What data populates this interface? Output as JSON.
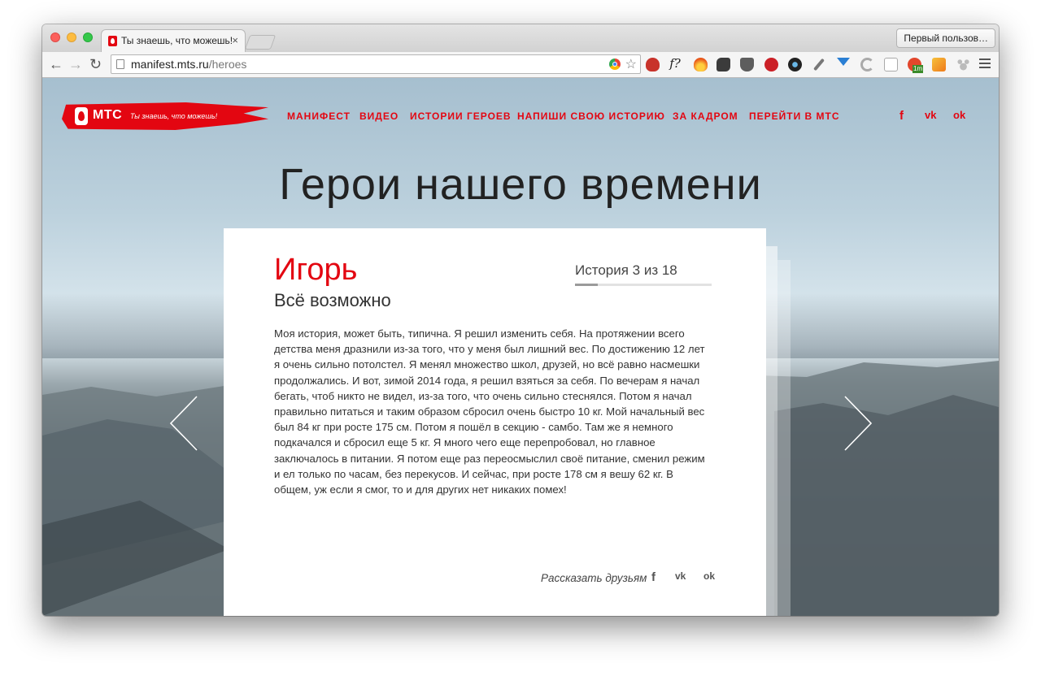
{
  "browser": {
    "tab_title": "Ты знаешь, что можешь!",
    "tab_close": "×",
    "profile_label": "Первый пользов…",
    "url_host": "manifest.mts.ru",
    "url_path": "/heroes",
    "back": "←",
    "forward": "→",
    "reload": "↻",
    "star": "☆",
    "extension_icons": [
      "ublock-icon",
      "font-icon",
      "flame-icon",
      "evernote-icon",
      "pocket-icon",
      "pinterest-icon",
      "lens-icon",
      "eyedropper-icon",
      "yandex-icon",
      "spinner-icon",
      "reader-icon",
      "badge-1m-icon",
      "chart-icon",
      "paw-icon"
    ],
    "ext_font_label": "f?",
    "ext_badge": "1m"
  },
  "site": {
    "brand": "МТС",
    "slogan": "Ты знаешь, что можешь!",
    "accent_color": "#e30611",
    "nav": [
      "МАНИФЕСТ",
      "ВИДЕО",
      "ИСТОРИИ ГЕРОЕВ",
      "НАПИШИ СВОЮ ИСТОРИЮ",
      "ЗА КАДРОМ",
      "ПЕРЕЙТИ В МТС"
    ],
    "social": [
      "f",
      "vk",
      "ok"
    ],
    "social_labels": {
      "facebook": "f",
      "vk": "vk",
      "ok": "ok"
    }
  },
  "hero": {
    "title": "Герои нашего времени"
  },
  "story": {
    "name": "Игорь",
    "subtitle": "Всё возможно",
    "counter": "История 3 из 18",
    "progress_fraction": 0.1667,
    "text": "Моя история, может быть, типична. Я решил изменить себя. На протяжении всего детства меня дразнили из-за того, что у меня был лишний вес. По достижению 12 лет я очень сильно потолстел. Я менял множество школ, друзей, но всё равно насмешки продолжались. И вот, зимой 2014 года, я решил взяться за себя. По вечерам я начал бегать, чтоб никто не видел, из-за того, что очень сильно стеснялся. Потом я начал правильно питаться и таким образом сбросил очень быстро 10 кг. Мой начальный вес был 84 кг при росте 175 см. Потом я пошёл в секцию - самбо. Там же я немного подкачался и сбросил еще 5 кг. Я много чего еще перепробовал, но главное заключалось в питании. Я потом еще раз переосмыслил своё питание, сменил режим и ел только по часам, без перекусов. И сейчас, при росте 178 см я вешу 62 кг. В общем, уж если я смог, то и для других нет никаких помех!",
    "share_label": "Рассказать друзьям"
  }
}
